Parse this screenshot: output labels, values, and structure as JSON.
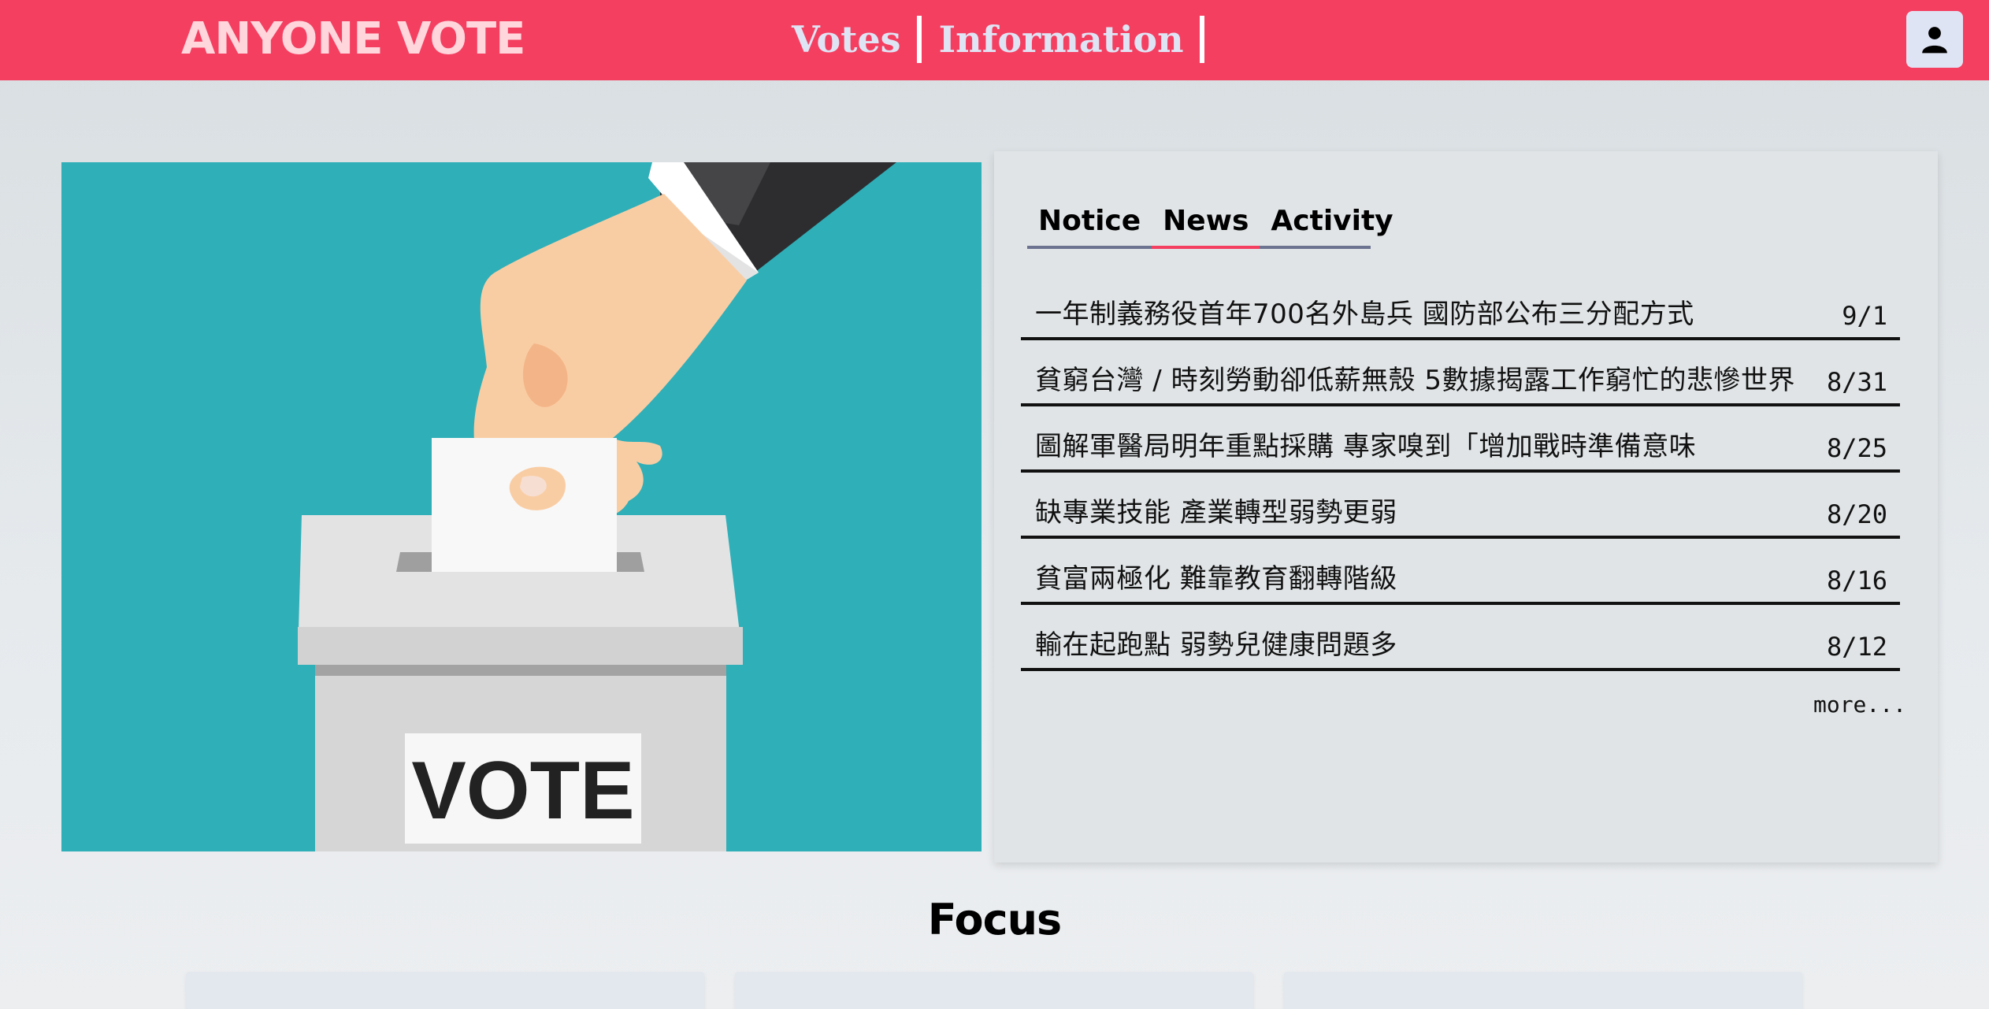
{
  "header": {
    "brand": "ANYONE VOTE",
    "nav": [
      {
        "label": "Votes"
      },
      {
        "label": "Information"
      }
    ],
    "user_icon": "user-icon"
  },
  "hero": {
    "image_label": "VOTE",
    "accent_color": "#2fafb8"
  },
  "tabs": [
    {
      "label": "Notice",
      "active": false
    },
    {
      "label": "News",
      "active": true
    },
    {
      "label": "Activity",
      "active": false
    }
  ],
  "news": [
    {
      "title": "一年制義務役首年700名外島兵 國防部公布三分配方式",
      "date": "9/1"
    },
    {
      "title": "貧窮台灣 / 時刻勞動卻低薪無殼 5數據揭露工作窮忙的悲慘世界",
      "date": "8/31"
    },
    {
      "title": "圖解軍醫局明年重點採購 專家嗅到「增加戰時準備意味",
      "date": "8/25"
    },
    {
      "title": "缺專業技能 產業轉型弱勢更弱",
      "date": "8/20"
    },
    {
      "title": "貧富兩極化 難靠教育翻轉階級",
      "date": "8/16"
    },
    {
      "title": "輸在起跑點 弱勢兒健康問題多",
      "date": "8/12"
    }
  ],
  "more_label": "more...",
  "focus": {
    "title": "Focus"
  },
  "colors": {
    "brand": "#f43f61",
    "nav_text": "#dfe4f4"
  }
}
